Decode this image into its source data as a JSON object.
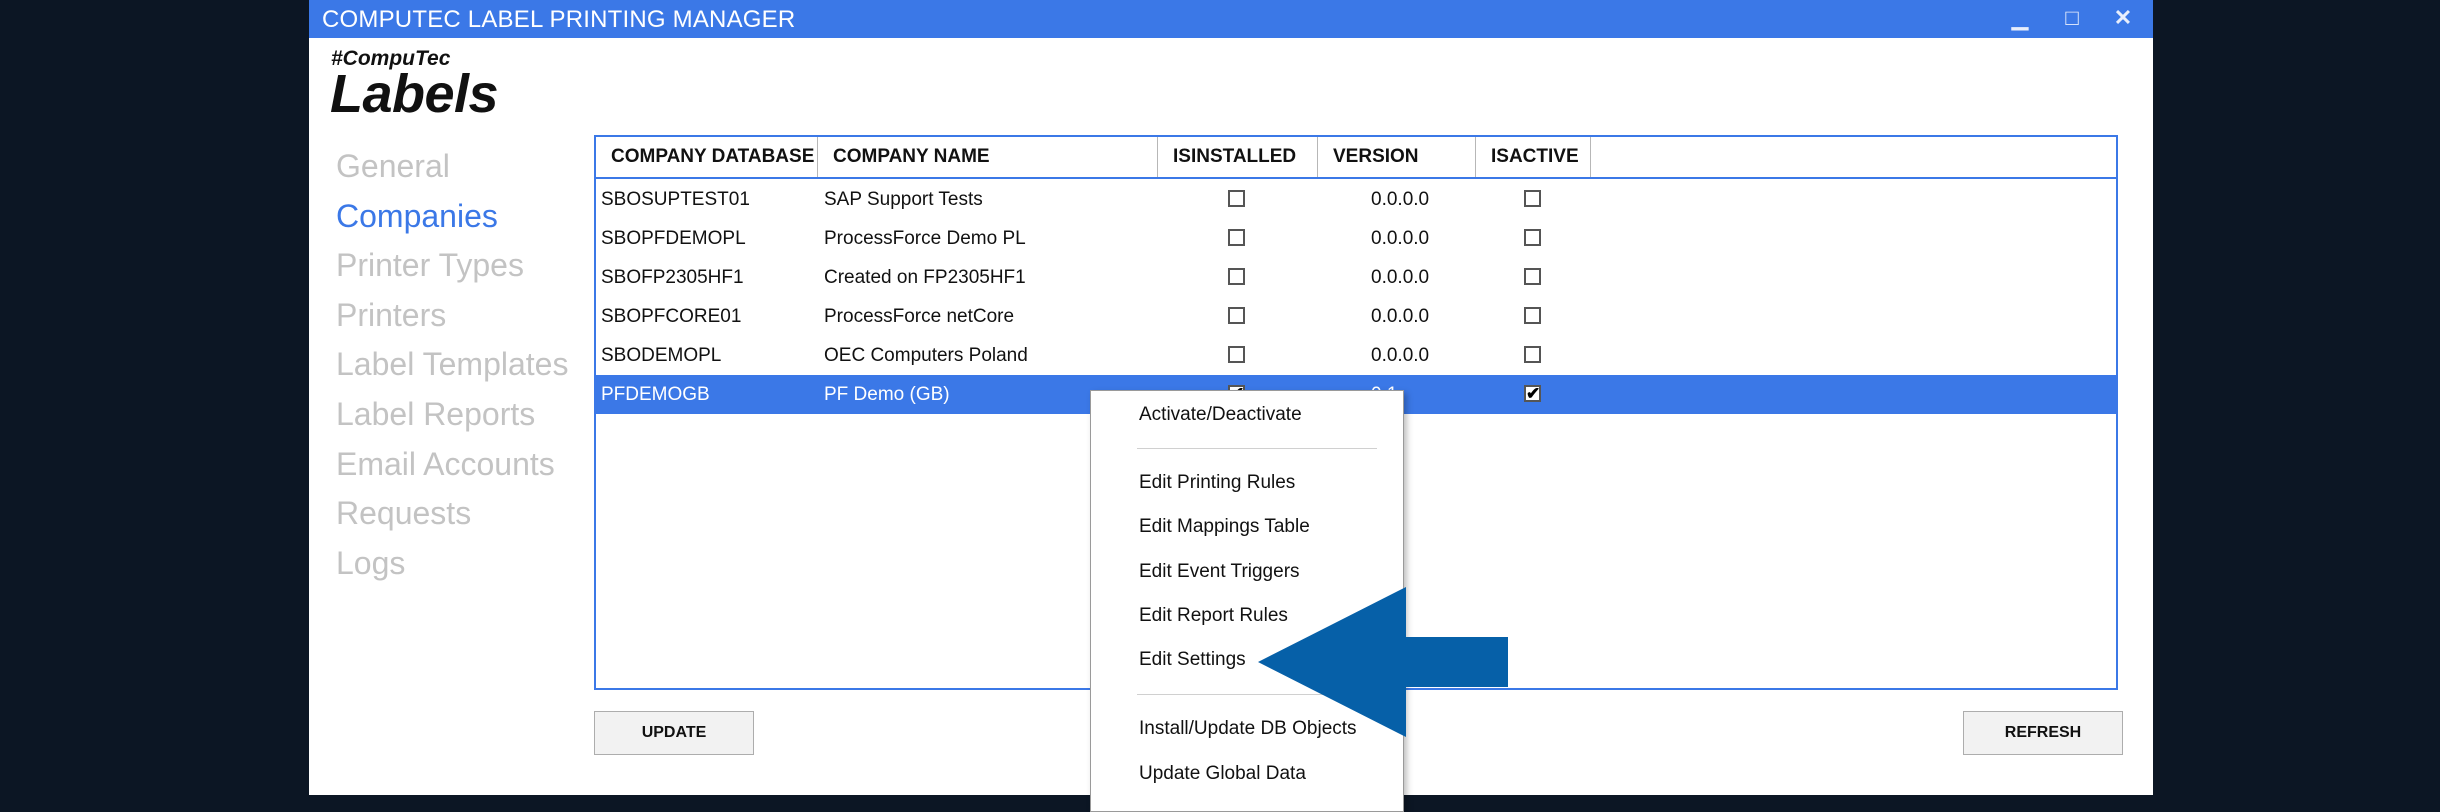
{
  "window": {
    "title": "COMPUTEC LABEL PRINTING MANAGER",
    "minimize_icon": "minimize-icon",
    "maximize_icon": "maximize-icon",
    "close_icon": "close-icon"
  },
  "logo": {
    "tag": "#CompuTec",
    "name": "Labels"
  },
  "sidebar": {
    "items": [
      {
        "label": "General",
        "active": false
      },
      {
        "label": "Companies",
        "active": true
      },
      {
        "label": "Printer Types",
        "active": false
      },
      {
        "label": "Printers",
        "active": false
      },
      {
        "label": "Label Templates",
        "active": false
      },
      {
        "label": "Label Reports",
        "active": false
      },
      {
        "label": "Email Accounts",
        "active": false
      },
      {
        "label": "Requests",
        "active": false
      },
      {
        "label": "Logs",
        "active": false
      }
    ]
  },
  "table": {
    "columns": [
      "COMPANY DATABASE",
      "COMPANY NAME",
      "ISINSTALLED",
      "VERSION",
      "ISACTIVE"
    ],
    "rows": [
      {
        "db": "SBOSUPTEST01",
        "name": "SAP Support Tests",
        "installed": false,
        "version": "0.0.0.0",
        "active": false,
        "selected": false
      },
      {
        "db": "SBOPFDEMOPL",
        "name": "ProcessForce Demo PL",
        "installed": false,
        "version": "0.0.0.0",
        "active": false,
        "selected": false
      },
      {
        "db": "SBOFP2305HF1",
        "name": "Created on FP2305HF1",
        "installed": false,
        "version": "0.0.0.0",
        "active": false,
        "selected": false
      },
      {
        "db": "SBOPFCORE01",
        "name": "ProcessForce netCore",
        "installed": false,
        "version": "0.0.0.0",
        "active": false,
        "selected": false
      },
      {
        "db": "SBODEMOPL",
        "name": "OEC Computers Poland",
        "installed": false,
        "version": "0.0.0.0",
        "active": false,
        "selected": false
      },
      {
        "db": "PFDEMOGB",
        "name": "PF Demo (GB)",
        "installed": true,
        "version": "0.1",
        "active": true,
        "selected": true
      }
    ]
  },
  "buttons": {
    "update": "UPDATE",
    "refresh": "REFRESH"
  },
  "context_menu": {
    "items": [
      "Activate/Deactivate",
      "Edit Printing Rules",
      "Edit Mappings Table",
      "Edit Event Triggers",
      "Edit Report Rules",
      "Edit Settings",
      "Install/Update DB Objects",
      "Update Global Data"
    ]
  },
  "colors": {
    "accent": "#3b78e7",
    "annotation_arrow": "#0660a8",
    "background": "#0c1624"
  }
}
